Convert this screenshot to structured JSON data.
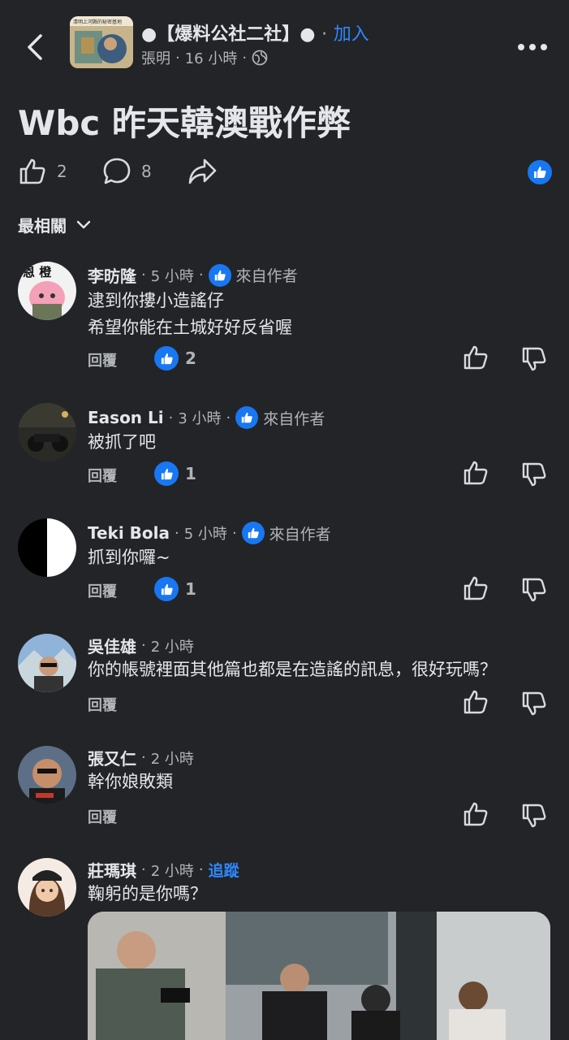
{
  "header": {
    "group_name": "●【爆料公社二社】●",
    "dot": "·",
    "join_label": "加入",
    "author": "張明",
    "time": "16 小時",
    "thumb_caption": "清明上河縣的秘密基地"
  },
  "post": {
    "title": "Wbc 昨天韓澳戰作弊",
    "like_count": "2",
    "comment_count": "8"
  },
  "sort": {
    "label": "最相關"
  },
  "labels": {
    "reply": "回覆",
    "from_author": "來自作者",
    "follow": "追蹤",
    "dot": "·"
  },
  "comments": [
    {
      "name": "李昉隆",
      "time": "5 小時",
      "line1": "逮到你摟小造謠仔",
      "line2": "希望你能在土城好好反省喔",
      "likes": "2",
      "avatar_text": "恩 橙"
    },
    {
      "name": "Eason Li",
      "time": "3 小時",
      "line1": "被抓了吧",
      "likes": "1"
    },
    {
      "name": "Teki Bola",
      "time": "5 小時",
      "line1": "抓到你囉~",
      "likes": "1"
    },
    {
      "name": "吳佳雄",
      "time": "2 小時",
      "line1": "你的帳號裡面其他篇也都是在造謠的訊息，很好玩嗎？"
    },
    {
      "name": "張又仁",
      "time": "2 小時",
      "line1": "幹你娘敗類"
    },
    {
      "name": "莊瑪琪",
      "time": "2 小時",
      "line1": "鞠躬的是你嗎？"
    }
  ],
  "colors": {
    "background": "#232427",
    "accent": "#2d88ff",
    "like_blue": "#1877f2",
    "text": "#e4e6eb",
    "muted": "#b0b3b8"
  },
  "icons": [
    "back-chevron-icon",
    "globe-icon",
    "more-dots-icon",
    "thumbs-up-icon",
    "comment-bubble-icon",
    "share-arrow-icon",
    "chevron-down-icon",
    "thumbs-down-icon"
  ]
}
